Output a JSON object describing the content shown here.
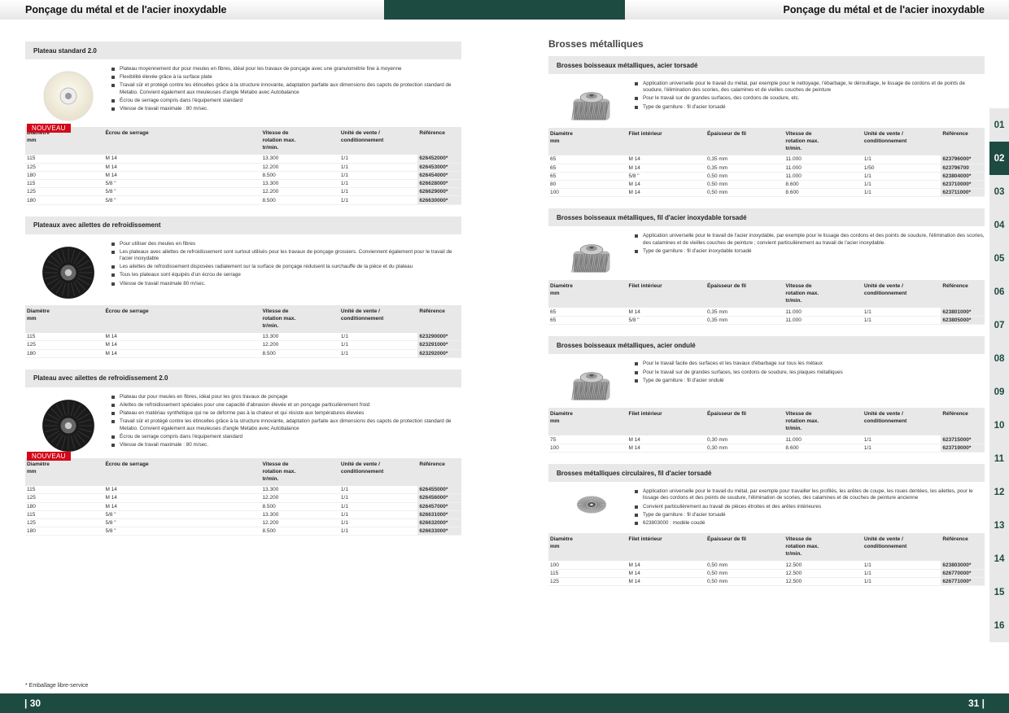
{
  "header": {
    "left_title": "Ponçage du métal et de l'acier inoxydable",
    "right_title": "Ponçage du métal et de l'acier inoxydable"
  },
  "footer": {
    "left_page": "| 30",
    "right_page": "31 |",
    "note": "* Emballage libre-service"
  },
  "right_heading": "Brosses métalliques",
  "tabs": [
    "01",
    "02",
    "03",
    "04",
    "05",
    "06",
    "07",
    "08",
    "09",
    "10",
    "11",
    "12",
    "13",
    "14",
    "15",
    "16"
  ],
  "active_tab": "02",
  "badge": "NOUVEAU",
  "left_sections": [
    {
      "title": "Plateau standard 2.0",
      "badge": true,
      "image": "felt-pad",
      "bullets": [
        "Plateau moyennement dur pour meules en fibres, idéal pour les travaux de ponçage avec une granulométrie fine à moyenne",
        "Flexibilité élevée grâce à la surface plate",
        "Travail sûr et protégé contre les étincelles grâce à la structure innovante, adaptation parfaite aux dimensions des capots de protection standard de Metabo. Convient également aux meuleuses d'angle Metabo avec Autobalance",
        "Écrou de serrage compris dans l'équipement standard",
        "Vitesse de travail maximale : 80 m/sec."
      ],
      "headers": [
        "Diamètre\nmm",
        "Écrou de serrage",
        "Vitesse de\nrotation max.\ntr/min.",
        "Unité de vente /\nconditionnement",
        "Référence"
      ],
      "rows": [
        [
          "115",
          "M 14",
          "13.300",
          "1/1",
          "626452000*"
        ],
        [
          "125",
          "M 14",
          "12.200",
          "1/1",
          "626453000*"
        ],
        [
          "180",
          "M 14",
          "8.500",
          "1/1",
          "626454000*"
        ],
        [
          "115",
          "5/8 \"",
          "13.300",
          "1/1",
          "626628000*"
        ],
        [
          "125",
          "5/8 \"",
          "12.200",
          "1/1",
          "626629000*"
        ],
        [
          "180",
          "5/8 \"",
          "8.500",
          "1/1",
          "626630000*"
        ]
      ]
    },
    {
      "title": "Plateaux avec ailettes de refroidissement",
      "badge": false,
      "image": "black-pad",
      "bullets": [
        "Pour utiliser des meules en fibres",
        "Les plateaux avec ailettes de refroidissement sont surtout utilisés pour les travaux de ponçage grossiers. Conviennent également pour le travail de l'acier inoxydable",
        "Les ailettes de refroidissement disposées radialement sur la surface de ponçage réduisent la surchauffe de la pièce et du plateau",
        "Tous les plateaux sont équipés d'un écrou de serrage",
        "Vitesse de travail maximale 80 m/sec."
      ],
      "headers": [
        "Diamètre\nmm",
        "Écrou de serrage",
        "Vitesse de\nrotation max.\ntr/min.",
        "Unité de vente /\nconditionnement",
        "Référence"
      ],
      "rows": [
        [
          "115",
          "M 14",
          "13.300",
          "1/1",
          "623290000*"
        ],
        [
          "125",
          "M 14",
          "12.200",
          "1/1",
          "623291000*"
        ],
        [
          "180",
          "M 14",
          "8.500",
          "1/1",
          "623292000*"
        ]
      ]
    },
    {
      "title": "Plateau avec ailettes de refroidissement 2.0",
      "badge": true,
      "image": "black-pad",
      "bullets": [
        "Plateau dur pour meules en fibres, idéal pour les gros travaux de ponçage",
        "Ailettes de refroidissement spéciales pour une capacité d'abrasion élevée et un ponçage particulièrement froid",
        "Plateau en matériau synthétique qui ne se déforme pas à la chaleur et qui résiste aux températures élevées",
        "Travail sûr et protégé contre les étincelles grâce à la structure innovante, adaptation parfaite aux dimensions des capots de protection standard de Metabo. Convient également aux meuleuses d'angle Metabo avec Autobalance",
        "Écrou de serrage compris dans l'équipement standard",
        "Vitesse de travail maximale : 80 m/sec."
      ],
      "headers": [
        "Diamètre\nmm",
        "Écrou de serrage",
        "Vitesse de\nrotation max.\ntr/min.",
        "Unité de vente /\nconditionnement",
        "Référence"
      ],
      "rows": [
        [
          "115",
          "M 14",
          "13.300",
          "1/1",
          "626455000*"
        ],
        [
          "125",
          "M 14",
          "12.200",
          "1/1",
          "626456000*"
        ],
        [
          "180",
          "M 14",
          "8.500",
          "1/1",
          "626457000*"
        ],
        [
          "115",
          "5/8 \"",
          "13.300",
          "1/1",
          "626631000*"
        ],
        [
          "125",
          "5/8 \"",
          "12.200",
          "1/1",
          "626632000*"
        ],
        [
          "180",
          "5/8 \"",
          "8.500",
          "1/1",
          "626633000*"
        ]
      ]
    }
  ],
  "right_sections": [
    {
      "title": "Brosses boisseaux métalliques, acier torsadé",
      "badge": false,
      "image": "cup-brush",
      "bullets": [
        "Application universelle pour le travail du métal, par exemple pour le nettoyage, l'ébarbage, le dérouillage, le lissage de cordons et de points de soudure, l'élimination des scories, des calamines et de vieilles couches de peinture",
        "Pour le travail sur de grandes surfaces, des cordons de soudure, etc.",
        "Type de garniture : fil d'acier torsadé"
      ],
      "headers": [
        "Diamètre\nmm",
        "Filet intérieur",
        "Épaisseur de fil",
        "Vitesse de\nrotation max.\ntr/min.",
        "Unité de vente /\nconditionnement",
        "Référence"
      ],
      "rows": [
        [
          "65",
          "M 14",
          "0,35 mm",
          "11.000",
          "1/1",
          "623796000*"
        ],
        [
          "65",
          "M 14",
          "0,35 mm",
          "11.000",
          "1/50",
          "623796700"
        ],
        [
          "65",
          "5/8 \"",
          "0,50 mm",
          "11.000",
          "1/1",
          "623804000*"
        ],
        [
          "80",
          "M 14",
          "0,50 mm",
          "8.600",
          "1/1",
          "623710000*"
        ],
        [
          "100",
          "M 14",
          "0,50 mm",
          "8.600",
          "1/1",
          "623711000*"
        ]
      ]
    },
    {
      "title": "Brosses boisseaux métalliques, fil d'acier inoxydable torsadé",
      "badge": false,
      "image": "cup-brush",
      "bullets": [
        "Application universelle pour le travail de l'acier inoxydable, par exemple pour le lissage des cordons et des points de soudure, l'élimination des scories, des calamines et de vieilles couches de peinture ; convient particulièrement au travail de l'acier inoxydable.",
        "Type de garniture : fil d'acier inoxydable torsadé"
      ],
      "headers": [
        "Diamètre\nmm",
        "Filet intérieur",
        "Épaisseur de fil",
        "Vitesse de\nrotation max.\ntr/min.",
        "Unité de vente /\nconditionnement",
        "Référence"
      ],
      "rows": [
        [
          "65",
          "M 14",
          "0,35 mm",
          "11.000",
          "1/1",
          "623801000*"
        ],
        [
          "65",
          "5/8 \"",
          "0,35 mm",
          "11.000",
          "1/1",
          "623805000*"
        ]
      ]
    },
    {
      "title": "Brosses boisseaux métalliques, acier ondulé",
      "badge": false,
      "image": "cup-brush-wave",
      "bullets": [
        "Pour le travail facile des surfaces et les travaux d'ébarbage sur tous les métaux",
        "Pour le travail sur de grandes surfaces, les cordons de soudure, les plaques métalliques",
        "Type de garniture : fil d'acier ondulé"
      ],
      "headers": [
        "Diamètre\nmm",
        "Filet intérieur",
        "Épaisseur de fil",
        "Vitesse de\nrotation max.\ntr/min.",
        "Unité de vente /\nconditionnement",
        "Référence"
      ],
      "rows": [
        [
          "75",
          "M 14",
          "0,30 mm",
          "11.000",
          "1/1",
          "623715000*"
        ],
        [
          "100",
          "M 14",
          "0,30 mm",
          "8.600",
          "1/1",
          "623719000*"
        ]
      ]
    },
    {
      "title": "Brosses métalliques circulaires, fil d'acier torsadé",
      "badge": false,
      "image": "wheel-brush",
      "bullets": [
        "Application universelle pour le travail du métal, par exemple pour travailler les profilés, les arêtes de coupe, les roues dentées, les ailettes, pour le lissage des cordons et des points de soudure, l'élimination de scories, des calamines et de couches de peinture ancienne",
        "Convient particulièrement au travail de pièces étroites et des arêtes intérieures",
        "Type de garniture : fil d'acier torsadé",
        "623803000 : modèle coudé"
      ],
      "headers": [
        "Diamètre\nmm",
        "Filet intérieur",
        "Épaisseur de fil",
        "Vitesse de\nrotation max.\ntr/min.",
        "Unité de vente /\nconditionnement",
        "Référence"
      ],
      "rows": [
        [
          "100",
          "M 14",
          "0,50 mm",
          "12.500",
          "1/1",
          "623803000*"
        ],
        [
          "115",
          "M 14",
          "0,50 mm",
          "12.500",
          "1/1",
          "626770000*"
        ],
        [
          "125",
          "M 14",
          "0,50 mm",
          "12.500",
          "1/1",
          "626771000*"
        ]
      ]
    }
  ]
}
